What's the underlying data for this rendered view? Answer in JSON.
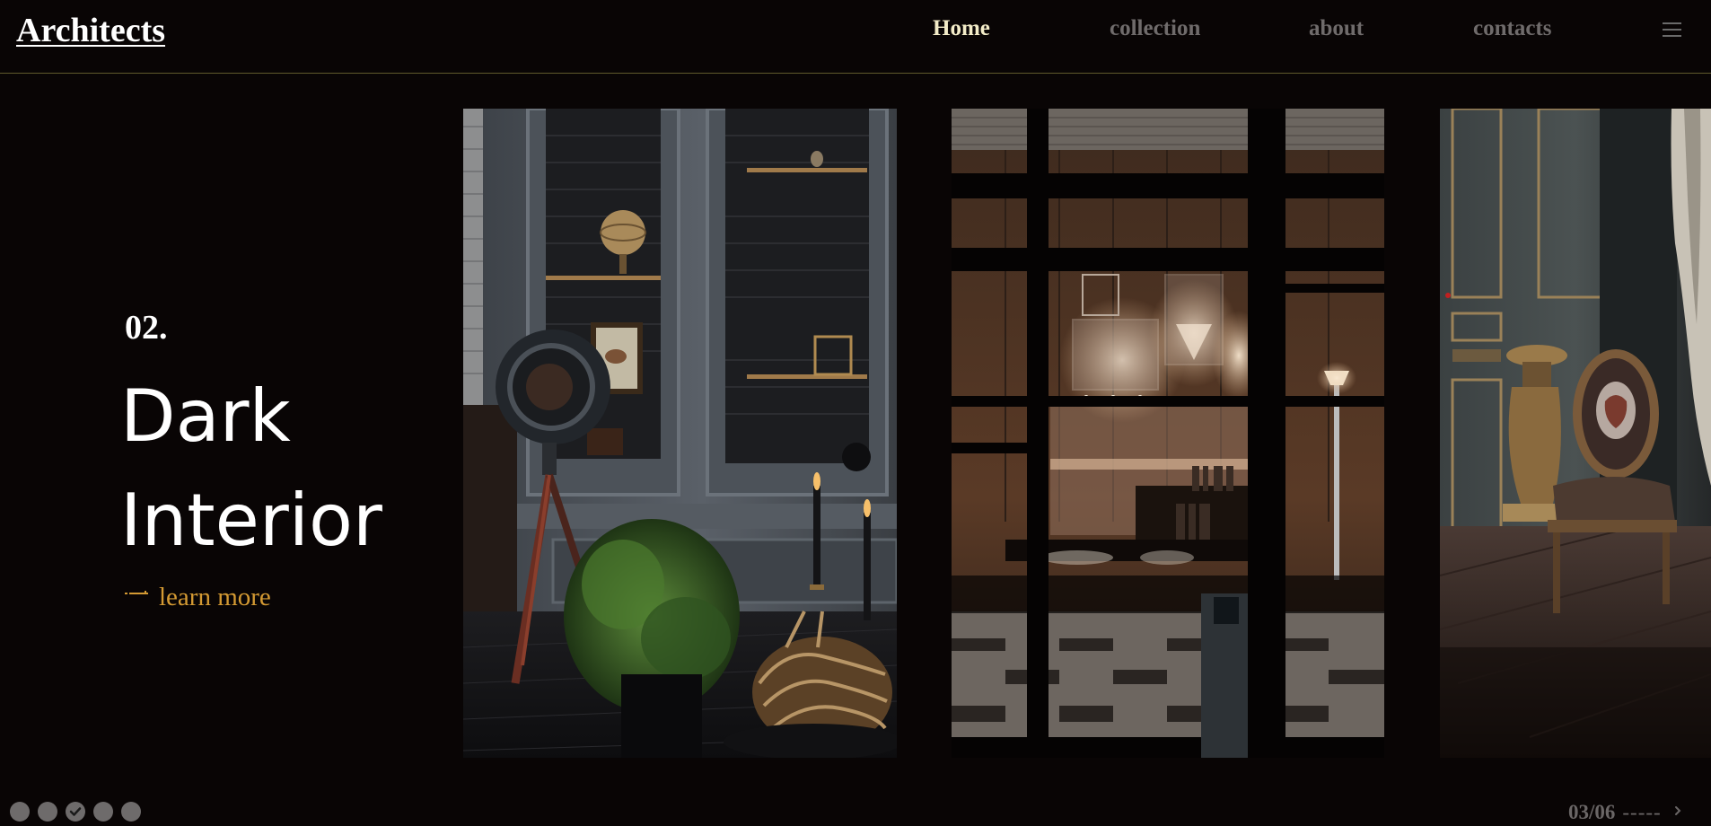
{
  "header": {
    "logo": "Architects",
    "nav": [
      {
        "label": "Home",
        "active": true
      },
      {
        "label": "collection",
        "active": false
      },
      {
        "label": "about",
        "active": false
      },
      {
        "label": "contacts",
        "active": false
      }
    ],
    "menu_icon": "hamburger-icon"
  },
  "hero": {
    "number": "02.",
    "title_line1": "Dark",
    "title_line2": "Interior",
    "cta": "learn more",
    "cta_icon": "dash-line-icon"
  },
  "gallery": [
    {
      "name": "living-room-shelves"
    },
    {
      "name": "glass-doors-chandelier"
    },
    {
      "name": "classic-chair-room"
    }
  ],
  "pagination": {
    "dot_count": 5,
    "active_dot": 3,
    "current": "03/06",
    "separator": "-----",
    "next_icon": "chevron-right-icon"
  },
  "colors": {
    "background": "#090505",
    "nav_active": "#f3ecc8",
    "nav_inactive": "#6f6b6b",
    "accent": "#d49a33",
    "divider": "#5f5a2c"
  }
}
